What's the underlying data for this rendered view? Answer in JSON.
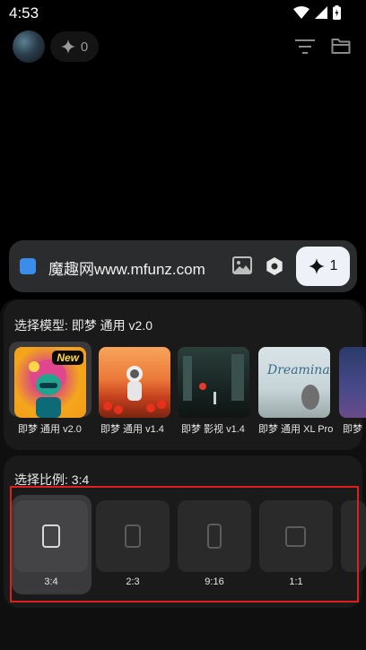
{
  "status_bar": {
    "time": "4:53"
  },
  "header": {
    "credits": "0"
  },
  "prompt": {
    "text": "魔趣网www.mfunz.com",
    "generate_count": "1"
  },
  "model_section": {
    "title": "选择模型: 即梦 通用 v2.0",
    "models": [
      {
        "label": "即梦 通用 v2.0",
        "badge": "New"
      },
      {
        "label": "即梦 通用 v1.4"
      },
      {
        "label": "即梦 影视 v1.4"
      },
      {
        "label": "即梦 通用 XL Pro"
      },
      {
        "label": "即梦"
      }
    ],
    "xl_thumb_text": "Dreamina Text"
  },
  "ratio_section": {
    "title": "选择比例: 3:4",
    "ratios": [
      {
        "label": "3:4"
      },
      {
        "label": "2:3"
      },
      {
        "label": "9:16"
      },
      {
        "label": "1:1"
      }
    ]
  },
  "colors": {
    "accent_blue": "#3a8eea",
    "highlight_red": "#e0201c",
    "badge_yellow": "#ffd84a"
  }
}
